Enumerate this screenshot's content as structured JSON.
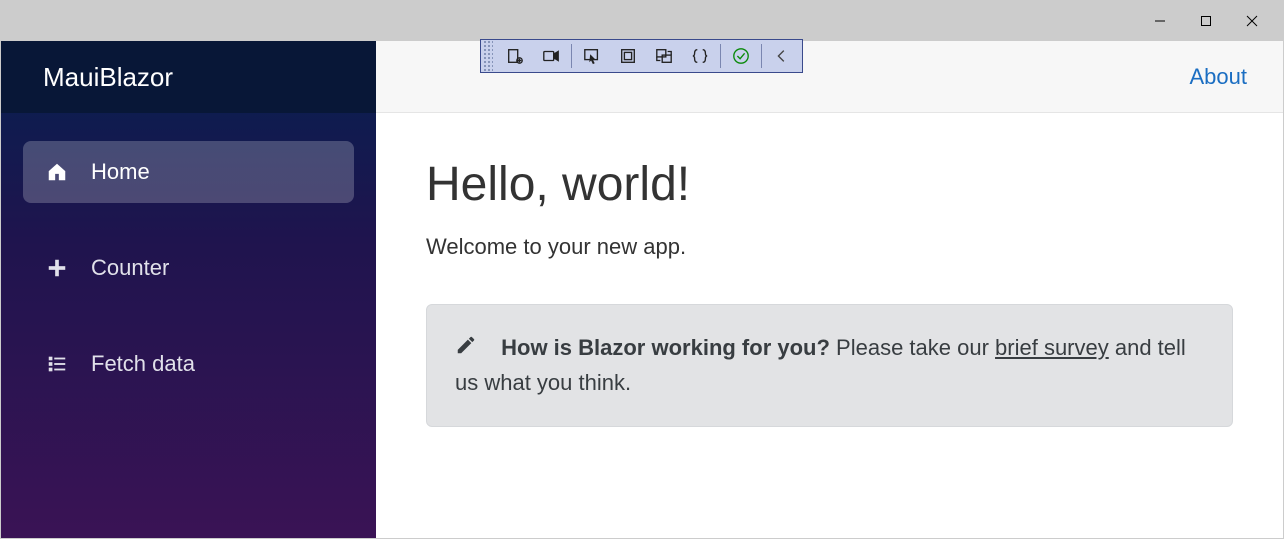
{
  "header": {
    "brand": "MauiBlazor",
    "about_link": "About"
  },
  "sidebar": {
    "items": [
      {
        "icon": "home-icon",
        "label": "Home",
        "active": true
      },
      {
        "icon": "plus-icon",
        "label": "Counter",
        "active": false
      },
      {
        "icon": "list-icon",
        "label": "Fetch data",
        "active": false
      }
    ]
  },
  "content": {
    "heading": "Hello, world!",
    "lead": "Welcome to your new app.",
    "alert": {
      "icon": "pencil-icon",
      "title": "How is Blazor working for you?",
      "body_prefix": " Please take our ",
      "link_text": "brief survey",
      "body_suffix": " and tell us what you think."
    }
  },
  "debug_toolbar": {
    "buttons": [
      "layout-icon",
      "video-icon",
      "pointer-icon",
      "square-icon",
      "swap-icon",
      "braces-icon",
      "check-circle-icon",
      "chevron-left-icon"
    ]
  },
  "window_controls": {
    "minimize": "minimize-icon",
    "maximize": "maximize-icon",
    "close": "close-icon"
  }
}
